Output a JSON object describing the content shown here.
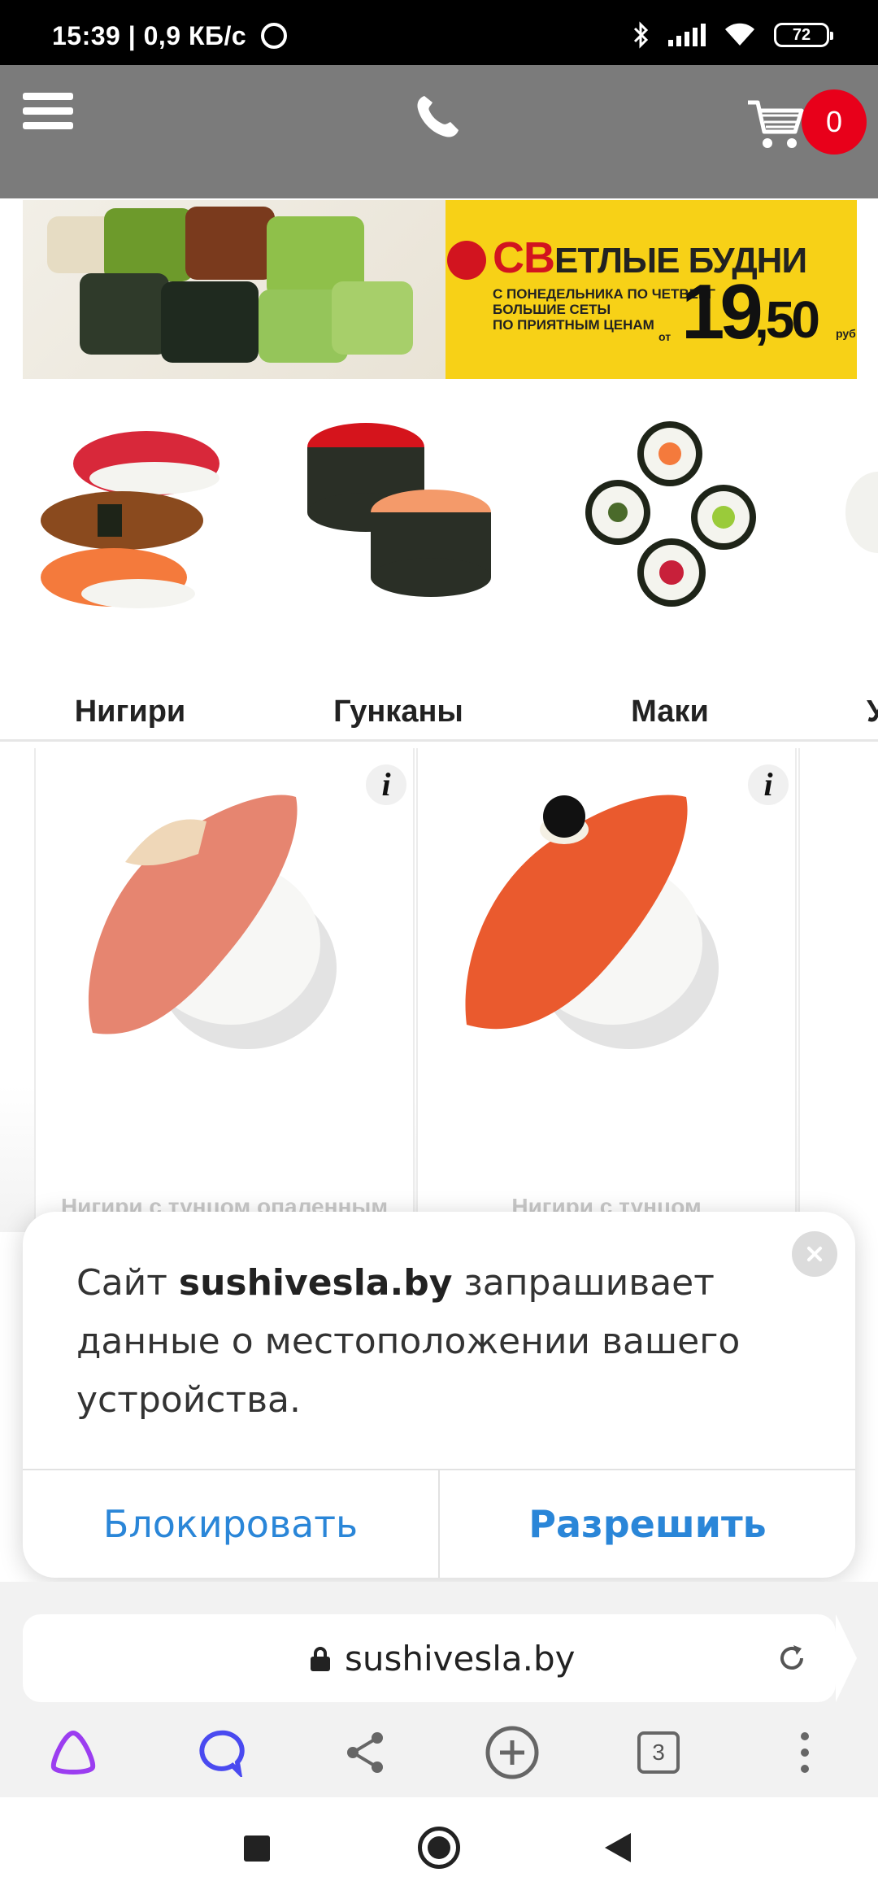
{
  "status_bar": {
    "time": "15:39",
    "net_speed": "| 0,9 КБ/с",
    "battery": "72"
  },
  "header": {
    "cart_count": "0"
  },
  "banner": {
    "brand_mark": "СВ",
    "title_rest": "ЕТЛЫЕ БУДНИ",
    "line1": "С ПОНЕДЕЛЬНИКА ПО ЧЕТВЕРГ",
    "line2": "БОЛЬШИЕ СЕТЫ",
    "line3": "ПО ПРИЯТНЫМ ЦЕНАМ",
    "price_prefix": "от",
    "price_whole": "19",
    "price_fraction": ",50",
    "currency": "руб"
  },
  "categories": [
    {
      "label": "Нигири"
    },
    {
      "label": "Гунканы"
    },
    {
      "label": "Маки"
    },
    {
      "label": "У"
    }
  ],
  "products": [
    {
      "name": "Нигири с тунцом опаленным",
      "info": "i"
    },
    {
      "name": "Нигири с тунцом",
      "info": "i"
    }
  ],
  "permission_dialog": {
    "text_prefix": "Сайт ",
    "site": "sushivesla.by",
    "text_suffix": " запрашивает данные о местоположении вашего устройства.",
    "block_label": "Блокировать",
    "allow_label": "Разрешить"
  },
  "browser": {
    "url": "sushivesla.by",
    "tabs_count": "3"
  },
  "colors": {
    "header_bg": "#7b7b7b",
    "cart_badge": "#e8001a",
    "dialog_button": "#2a86d8",
    "banner_bg": "#f7d117"
  }
}
